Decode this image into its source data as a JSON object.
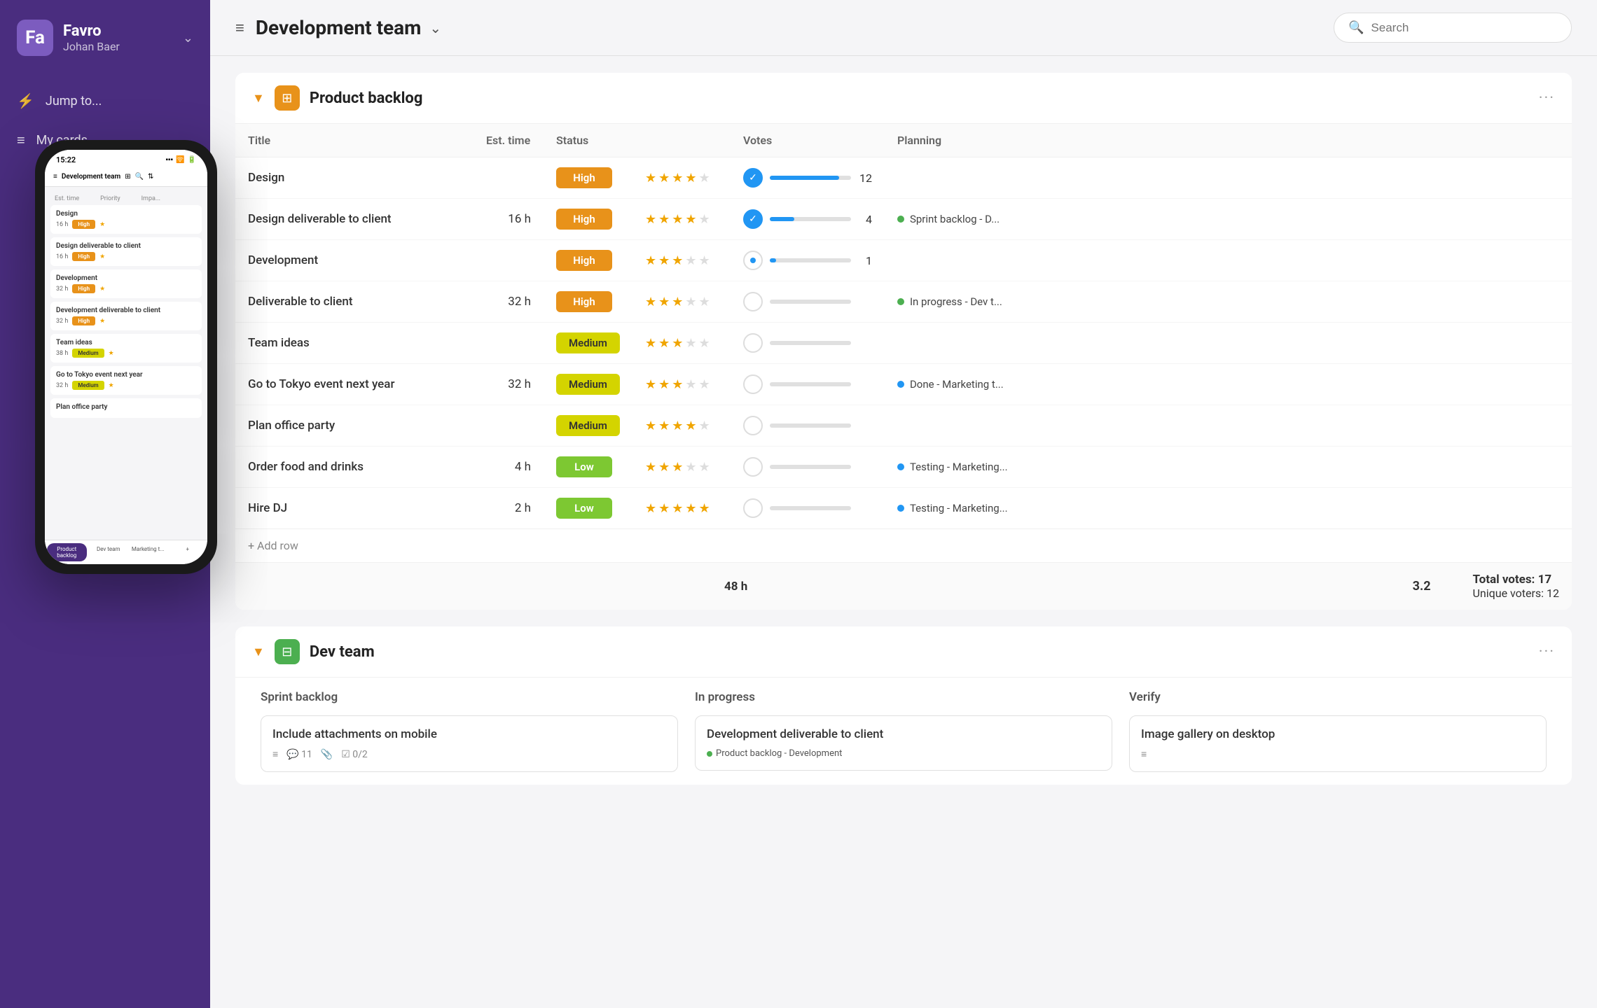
{
  "sidebar": {
    "app_name": "Favro",
    "username": "Johan Baer",
    "logo_letter": "Fa",
    "nav_items": [
      {
        "id": "jump-to",
        "icon": "⚡",
        "label": "Jump to..."
      },
      {
        "id": "my-cards",
        "icon": "≡",
        "label": "My cards"
      }
    ]
  },
  "topbar": {
    "menu_icon": "≡",
    "title": "Development team",
    "chevron": "⌄",
    "search_placeholder": "Search"
  },
  "product_backlog": {
    "title": "Product backlog",
    "columns": {
      "title": "Title",
      "est_time": "Est. time",
      "status": "Status",
      "stars_label": "",
      "votes": "Votes",
      "planning": "Planning"
    },
    "rows": [
      {
        "title": "Design",
        "est_time": "",
        "status": "High",
        "status_class": "status-high",
        "stars": 4,
        "max_stars": 5,
        "vote_checked": true,
        "vote_fill_pct": 85,
        "vote_count": 12,
        "planning": "",
        "planning_color": ""
      },
      {
        "title": "Design deliverable to client",
        "est_time": "16 h",
        "status": "High",
        "status_class": "status-high",
        "stars": 4,
        "max_stars": 5,
        "vote_checked": true,
        "vote_fill_pct": 30,
        "vote_count": 4,
        "planning": "Sprint backlog - D...",
        "planning_color": "green"
      },
      {
        "title": "Development",
        "est_time": "",
        "status": "High",
        "status_class": "status-high",
        "stars": 3,
        "max_stars": 5,
        "vote_checked": false,
        "vote_fill_pct": 8,
        "vote_count": 1,
        "planning": "",
        "planning_color": ""
      },
      {
        "title": "Deliverable to client",
        "est_time": "32 h",
        "status": "High",
        "status_class": "status-high",
        "stars": 3,
        "max_stars": 5,
        "vote_checked": false,
        "vote_fill_pct": 0,
        "vote_count": "",
        "planning": "In progress - Dev t...",
        "planning_color": "green"
      },
      {
        "title": "Team ideas",
        "est_time": "",
        "status": "Medium",
        "status_class": "status-medium",
        "stars": 3,
        "max_stars": 5,
        "vote_checked": false,
        "vote_fill_pct": 0,
        "vote_count": "",
        "planning": "",
        "planning_color": ""
      },
      {
        "title": "Go to Tokyo event next year",
        "est_time": "32 h",
        "status": "Medium",
        "status_class": "status-medium",
        "stars": 3,
        "max_stars": 5,
        "vote_checked": false,
        "vote_fill_pct": 0,
        "vote_count": "",
        "planning": "Done - Marketing t...",
        "planning_color": "blue"
      },
      {
        "title": "Plan office party",
        "est_time": "",
        "status": "Medium",
        "status_class": "status-medium",
        "stars": 4,
        "max_stars": 5,
        "vote_checked": false,
        "vote_fill_pct": 0,
        "vote_count": "",
        "planning": "",
        "planning_color": ""
      },
      {
        "title": "Order food and drinks",
        "est_time": "4 h",
        "status": "Low",
        "status_class": "status-low",
        "stars": 3,
        "max_stars": 5,
        "vote_checked": false,
        "vote_fill_pct": 0,
        "vote_count": "",
        "planning": "Testing - Marketing...",
        "planning_color": "blue"
      },
      {
        "title": "Hire DJ",
        "est_time": "2 h",
        "status": "Low",
        "status_class": "status-low",
        "stars": 5,
        "max_stars": 5,
        "vote_checked": false,
        "vote_fill_pct": 0,
        "vote_count": "",
        "planning": "Testing - Marketing...",
        "planning_color": "blue"
      }
    ],
    "footer": {
      "total_time": "48 h",
      "avg_rating": "3.2",
      "total_votes_label": "Total votes: 17",
      "unique_voters_label": "Unique voters: 12",
      "add_row_label": "+ Add row"
    }
  },
  "dev_team": {
    "title": "Dev team",
    "columns": [
      {
        "id": "sprint-backlog",
        "title": "Sprint backlog",
        "cards": [
          {
            "title": "Include attachments on mobile",
            "meta_icons": [
              "≡",
              "💬 11",
              "📎",
              "☑ 0/2"
            ]
          }
        ]
      },
      {
        "id": "in-progress",
        "title": "In progress",
        "cards": [
          {
            "title": "Development deliverable to client",
            "tag": "Product backlog - Development",
            "tag_color": "green"
          }
        ]
      },
      {
        "id": "verify",
        "title": "Verify",
        "cards": [
          {
            "title": "Image gallery on desktop",
            "meta_icons": [
              "≡"
            ]
          }
        ]
      }
    ]
  },
  "phone": {
    "time": "15:22",
    "header_title": "Development team",
    "rows": [
      {
        "title": "Design",
        "time": "16 h",
        "badge": "High",
        "badge_class": "phone-badge-high",
        "stars": 1
      },
      {
        "title": "Design deliverable to client",
        "time": "16 h",
        "badge": "High",
        "badge_class": "phone-badge-high",
        "stars": 1
      },
      {
        "title": "Development",
        "time": "32 h",
        "badge": "High",
        "badge_class": "phone-badge-high",
        "stars": 1
      },
      {
        "title": "Development deliverable to client",
        "time": "32 h",
        "badge": "High",
        "badge_class": "phone-badge-high",
        "stars": 1
      },
      {
        "title": "Team ideas",
        "time": "38 h",
        "badge": "Medium",
        "badge_class": "phone-badge-medium",
        "stars": 1
      },
      {
        "title": "Go to Tokyo event next year",
        "time": "32 h",
        "badge": "Medium",
        "badge_class": "phone-badge-medium",
        "stars": 1
      },
      {
        "title": "Plan office party",
        "time": "",
        "badge": "",
        "badge_class": "",
        "stars": 0
      }
    ],
    "tabs": [
      "Product backlog",
      "Dev team",
      "Marketing t...",
      "+"
    ]
  }
}
